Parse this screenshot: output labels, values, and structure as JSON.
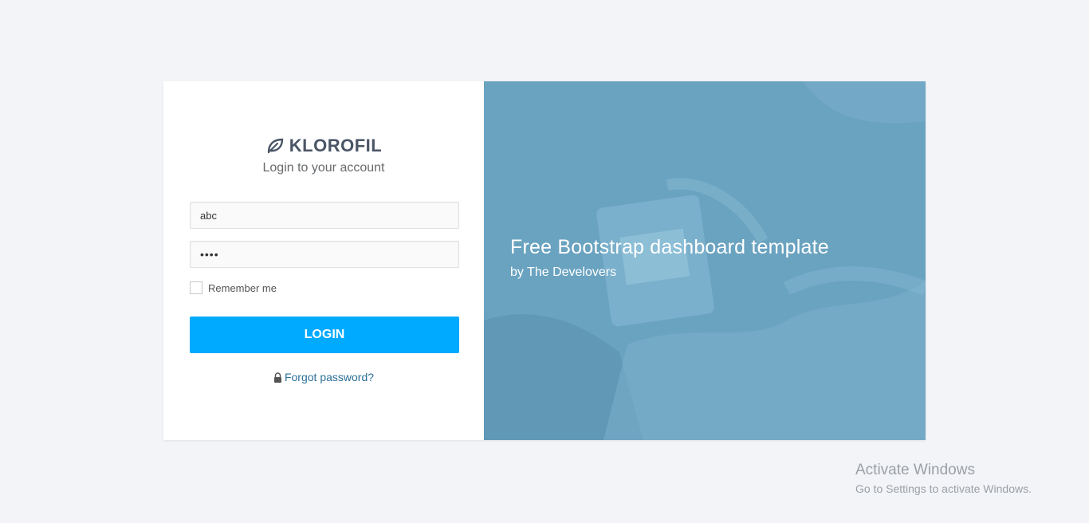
{
  "brand": {
    "name": "KLOROFIL",
    "icon": "leaf-icon"
  },
  "login": {
    "subtitle": "Login to your account",
    "username_value": "abc",
    "password_value": "••••",
    "remember_label": "Remember me",
    "remember_checked": false,
    "button_label": "LOGIN",
    "forgot_label": "Forgot password?"
  },
  "hero": {
    "title": "Free Bootstrap dashboard template",
    "subtitle": "by The Develovers"
  },
  "watermark": {
    "title": "Activate Windows",
    "subtitle": "Go to Settings to activate Windows."
  },
  "colors": {
    "background": "#f3f4f8",
    "accent": "#00aaff",
    "hero": "#6aa3c0",
    "link": "#2b6f97",
    "brand_text": "#4a5566"
  }
}
